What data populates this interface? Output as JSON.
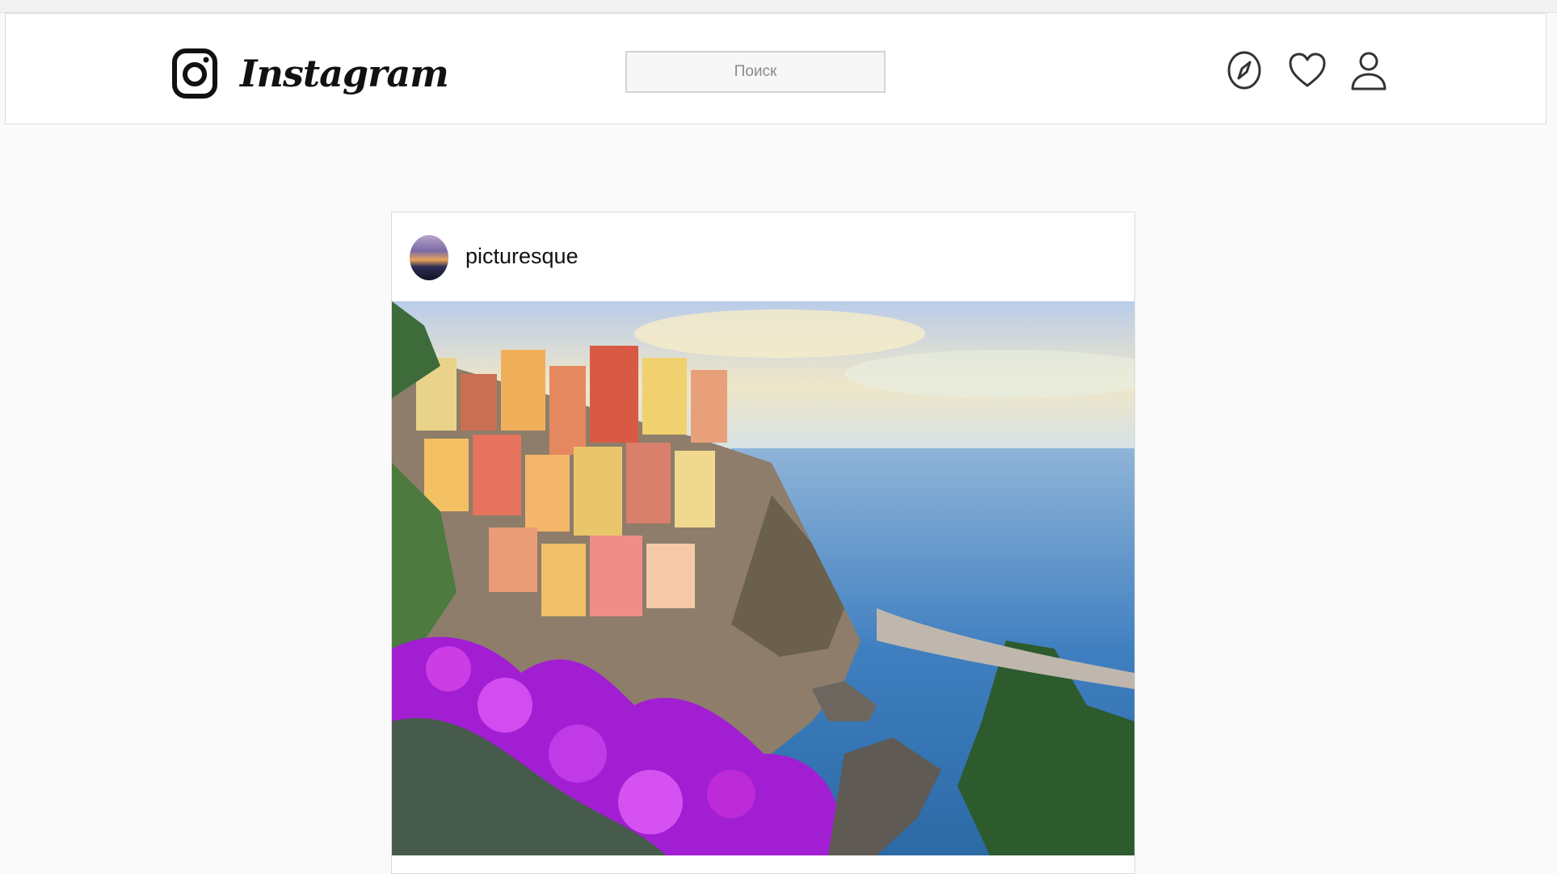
{
  "header": {
    "brand": "Instagram",
    "search": {
      "placeholder": "Поиск",
      "value": ""
    },
    "icons": [
      "explore-compass-icon",
      "heart-icon",
      "profile-icon"
    ]
  },
  "post": {
    "username": "picturesque",
    "image_subject": "coastal cliff village with colorful houses, sea and purple flowers"
  },
  "colors": {
    "background": "#fafafa",
    "surface": "#ffffff",
    "border": "#dbdbdb",
    "text": "#111111",
    "placeholder": "#8a8a8a"
  }
}
